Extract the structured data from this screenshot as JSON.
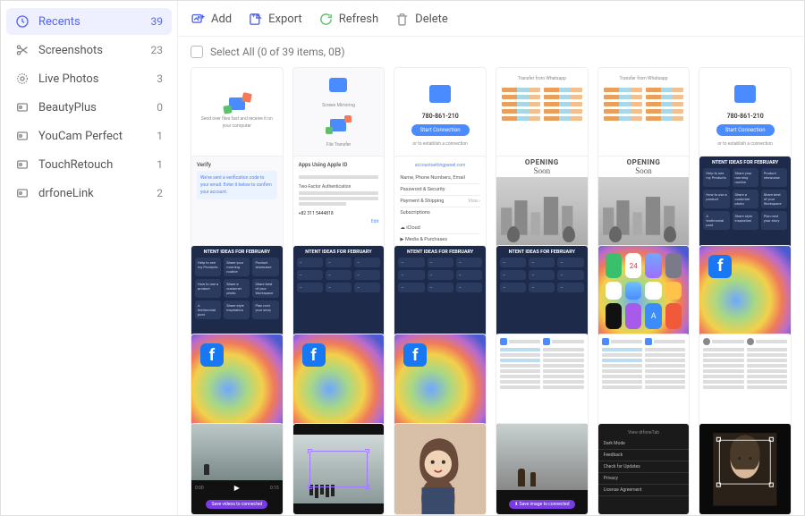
{
  "sidebar": {
    "items": [
      {
        "label": "Recents",
        "count": "39",
        "icon": "clock-icon",
        "active": true
      },
      {
        "label": "Screenshots",
        "count": "23",
        "icon": "scissors-icon"
      },
      {
        "label": "Live Photos",
        "count": "3",
        "icon": "circle-icon"
      },
      {
        "label": "BeautyPlus",
        "count": "0",
        "icon": "app-folder-icon"
      },
      {
        "label": "YouCam Perfect",
        "count": "1",
        "icon": "app-folder-icon"
      },
      {
        "label": "TouchRetouch",
        "count": "1",
        "icon": "app-folder-icon"
      },
      {
        "label": "drfoneLink",
        "count": "2",
        "icon": "app-folder-icon"
      }
    ]
  },
  "toolbar": {
    "add": "Add",
    "export": "Export",
    "refresh": "Refresh",
    "delete": "Delete"
  },
  "selectbar": {
    "label": "Select All (0 of 39 items, 0B)"
  },
  "thumbs": {
    "screen_mirroring": "Screen Mirroring",
    "file_transfer": "File Transfer",
    "phone_num": "780-861-210",
    "start_connection": "Start Connection",
    "opening_soon": "OPENING",
    "soon": "Soon",
    "ideas_feb": "NTENT IDEAS FOR FEBRUARY",
    "verify": "Verify",
    "appleid": "Apps Using Apple ID",
    "twofa": "Two-Factor Authentication",
    "settings_name": "Name, Phone Numbers, Email",
    "settings_pass": "Password & Security",
    "settings_pay": "Payment & Shipping",
    "settings_sub": "Subscriptions",
    "settings_icloud": "iCloud",
    "settings_media": "Media & Purchases",
    "darkmode": "Dark Mode",
    "feedback": "Feedback",
    "checkupdate": "Check for Updates",
    "privacy": "Privacy",
    "license": "License Agreement",
    "save_purple": "Save videos to connected"
  }
}
